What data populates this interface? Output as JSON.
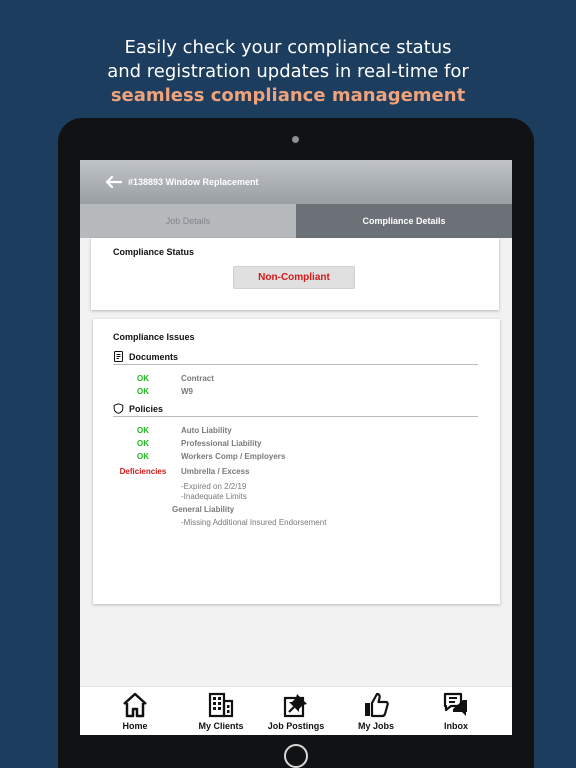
{
  "promo": {
    "line1": "Easily check your compliance status",
    "line2": "and registration updates in real-time for",
    "line3": "seamless compliance management"
  },
  "appbar": {
    "title": "#138893 Window Replacement",
    "back_icon": "arrow-left-icon"
  },
  "tabs": [
    {
      "label": "Job Details",
      "active": false
    },
    {
      "label": "Compliance Details",
      "active": true
    }
  ],
  "compliance_status": {
    "title": "Compliance Status",
    "value": "Non-Compliant"
  },
  "issues": {
    "title": "Compliance Issues",
    "documents": {
      "label": "Documents",
      "items": [
        {
          "status": "OK",
          "name": "Contract"
        },
        {
          "status": "OK",
          "name": "W9"
        }
      ]
    },
    "policies": {
      "label": "Policies",
      "items": [
        {
          "status": "OK",
          "name": "Auto Liability"
        },
        {
          "status": "OK",
          "name": "Professional Liability"
        },
        {
          "status": "OK",
          "name": "Workers Comp / Employers"
        },
        {
          "status": "Deficiencies",
          "name": "Umbrella / Excess"
        }
      ],
      "umbrella_notes": [
        "-Expired on 2/2/19",
        "-Inadequate Limits"
      ],
      "general_liability": {
        "name": "General Liability",
        "notes": [
          "-Missing Additional Insured Endorsement"
        ]
      }
    }
  },
  "nav": [
    {
      "label": "Home",
      "icon": "home-icon"
    },
    {
      "label": "My Clients",
      "icon": "building-icon"
    },
    {
      "label": "Job Postings",
      "icon": "pin-icon"
    },
    {
      "label": "My Jobs",
      "icon": "thumbs-up-icon"
    },
    {
      "label": "Inbox",
      "icon": "chat-icon"
    }
  ],
  "colors": {
    "background": "#1c3d5e",
    "accent": "#f0a27a",
    "ok": "#22b522",
    "error": "#d11a1a"
  }
}
